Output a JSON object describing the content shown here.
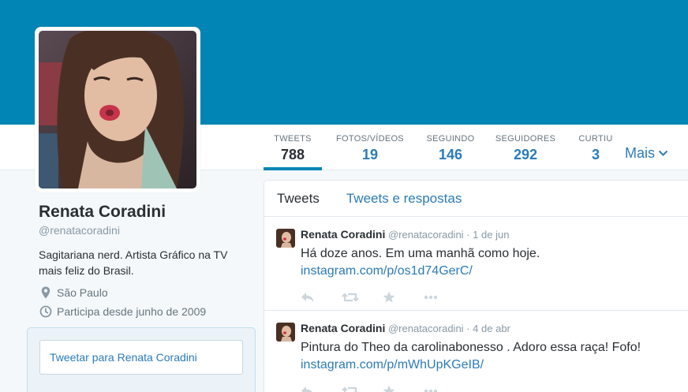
{
  "colors": {
    "banner": "#0085b4",
    "link": "#2b7bb9",
    "text": "#292f33",
    "muted": "#8899a6"
  },
  "nav": {
    "tabs": [
      {
        "label": "TWEETS",
        "value": "788"
      },
      {
        "label": "FOTOS/VÍDEOS",
        "value": "19"
      },
      {
        "label": "SEGUINDO",
        "value": "146"
      },
      {
        "label": "SEGUIDORES",
        "value": "292"
      },
      {
        "label": "CURTIU",
        "value": "3"
      }
    ],
    "more_label": "Mais"
  },
  "profile": {
    "name": "Renata Coradini",
    "handle": "@renatacoradini",
    "bio": "Sagitariana nerd. Artista Gráfico na TV mais feliz do Brasil.",
    "location": "São Paulo",
    "joined": "Participa desde junho de 2009",
    "icons": {
      "location": "map-pin-icon",
      "joined": "clock-icon"
    }
  },
  "tweet_to": {
    "placeholder": "Tweetar para Renata Coradini"
  },
  "timeline": {
    "tabs": [
      "Tweets",
      "Tweets e respostas"
    ],
    "tweets": [
      {
        "name": "Renata Coradini",
        "handle": "@renatacoradini",
        "date": "1 de jun",
        "text": "Há doze anos. Em uma manhã como hoje.",
        "link": "instagram.com/p/os1d74GerC/"
      },
      {
        "name": "Renata Coradini",
        "handle": "@renatacoradini",
        "date": "4 de abr",
        "text": "Pintura do Theo da carolinabonesso . Adoro essa raça! Fofo!",
        "link": "instagram.com/p/mWhUpKGeIB/"
      }
    ],
    "action_icons": [
      "reply-icon",
      "retweet-icon",
      "favorite-icon",
      "more-icon"
    ]
  }
}
